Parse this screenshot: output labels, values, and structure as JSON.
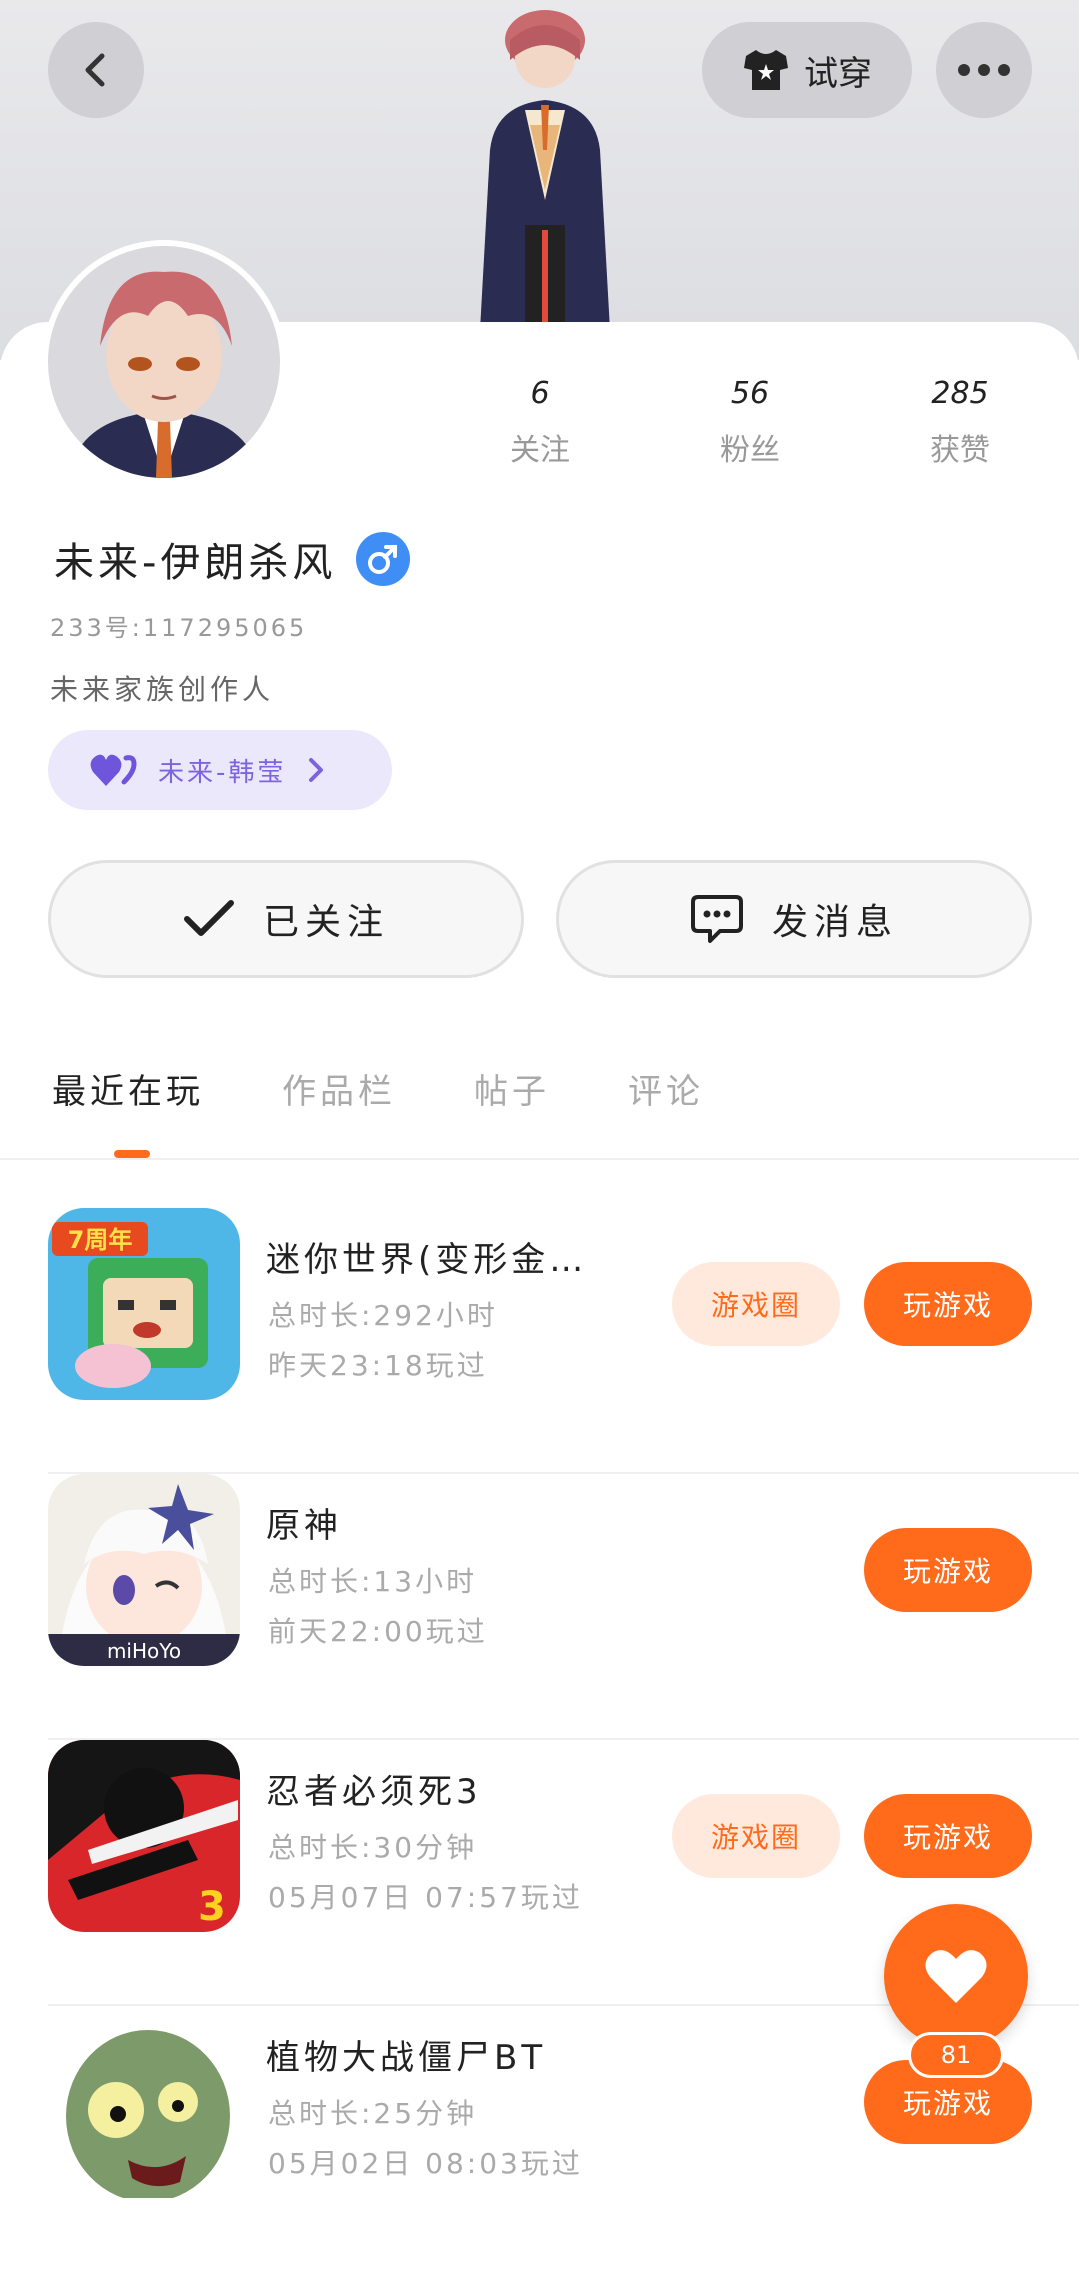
{
  "header": {
    "try_on_label": "试穿",
    "back_icon": "chevron-left-icon",
    "more_icon": "more-icon"
  },
  "stats": [
    {
      "value": "6",
      "label": "关注"
    },
    {
      "value": "56",
      "label": "粉丝"
    },
    {
      "value": "285",
      "label": "获赞"
    }
  ],
  "profile": {
    "name": "未来-伊朗杀风",
    "gender": "male",
    "id": "233号:117295065",
    "bio": "未来家族创作人",
    "family_tag": "未来-韩莹"
  },
  "actions": {
    "follow_label": "已关注",
    "message_label": "发消息"
  },
  "tabs": [
    {
      "label": "最近在玩",
      "active": true
    },
    {
      "label": "作品栏",
      "active": false
    },
    {
      "label": "帖子",
      "active": false
    },
    {
      "label": "评论",
      "active": false
    }
  ],
  "games": [
    {
      "title": "迷你世界(变形金…",
      "total_time": "总时长:292小时",
      "last_played": "昨天23:18玩过",
      "circle_label": "游戏圈",
      "play_label": "玩游戏"
    },
    {
      "title": "原神",
      "total_time": "总时长:13小时",
      "last_played": "前天22:00玩过",
      "circle_label": "",
      "play_label": "玩游戏"
    },
    {
      "title": "忍者必须死3",
      "total_time": "总时长:30分钟",
      "last_played": "05月07日 07:57玩过",
      "circle_label": "游戏圈",
      "play_label": "玩游戏"
    },
    {
      "title": "植物大战僵尸BT",
      "total_time": "总时长:25分钟",
      "last_played": "05月02日 08:03玩过",
      "circle_label": "",
      "play_label": "玩游戏"
    }
  ],
  "fab": {
    "count": "81"
  },
  "colors": {
    "accent": "#ff6b1a",
    "accent_light": "#ffe9dd",
    "family_tag_bg": "#ece8fb",
    "family_tag_text": "#7c64e0",
    "gender_blue": "#3f8ef5"
  }
}
